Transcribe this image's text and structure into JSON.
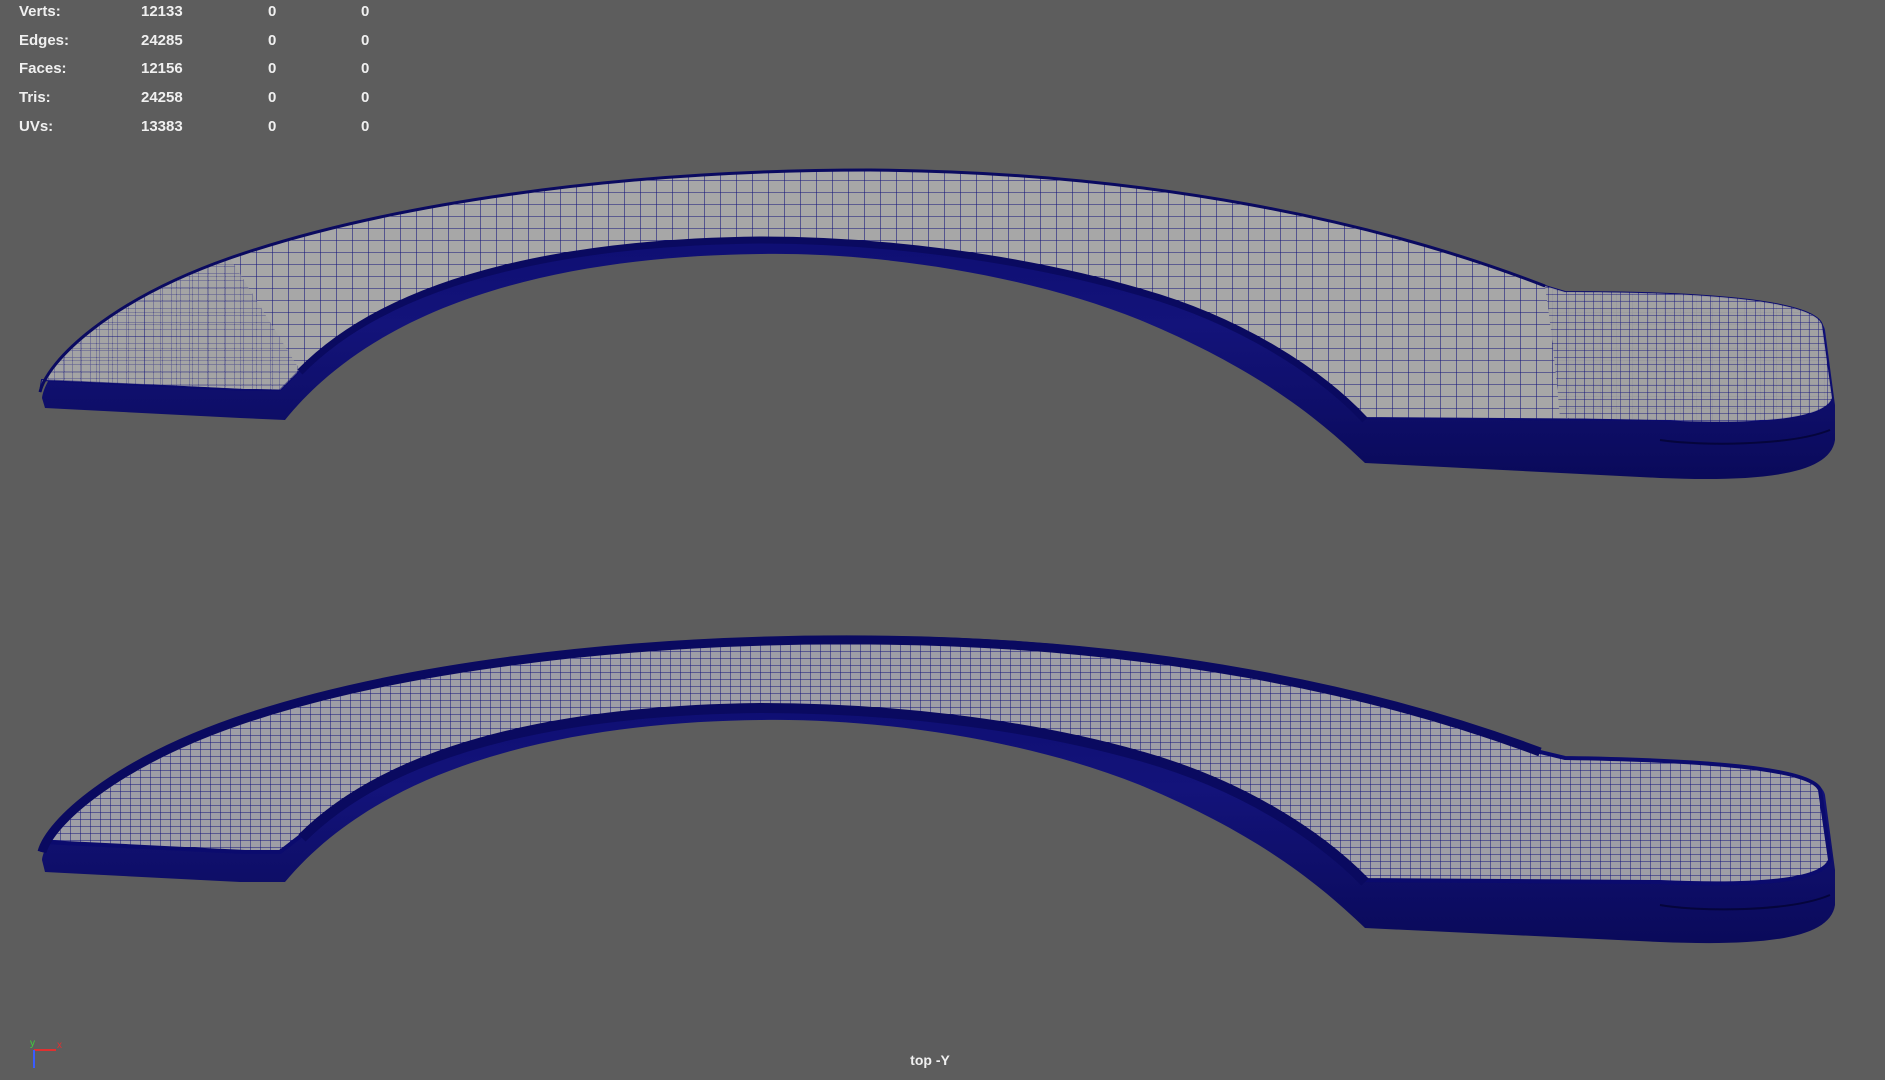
{
  "viewport": {
    "background": "#5d5d5d",
    "wire_color": "#0b0b6e",
    "surface_color": "#a7a7a7",
    "camera_label": "top -Y"
  },
  "hud": {
    "rows": [
      {
        "label": "Verts:",
        "values": [
          "12133",
          "0",
          "0"
        ]
      },
      {
        "label": "Edges:",
        "values": [
          "24285",
          "0",
          "0"
        ]
      },
      {
        "label": "Faces:",
        "values": [
          "12156",
          "0",
          "0"
        ]
      },
      {
        "label": "Tris:",
        "values": [
          "24258",
          "0",
          "0"
        ]
      },
      {
        "label": "UVs:",
        "values": [
          "13383",
          "0",
          "0"
        ]
      }
    ]
  },
  "gizmo": {
    "y_label": "y",
    "x_label": "x",
    "y_color": "#3cd23c",
    "x_color": "#e03030",
    "z_color": "#3a5cff"
  },
  "meshes": [
    {
      "name": "mesh-top",
      "shading": "wireframe-on-shaded"
    },
    {
      "name": "mesh-bottom",
      "shading": "wireframe-on-shaded-dense"
    }
  ]
}
